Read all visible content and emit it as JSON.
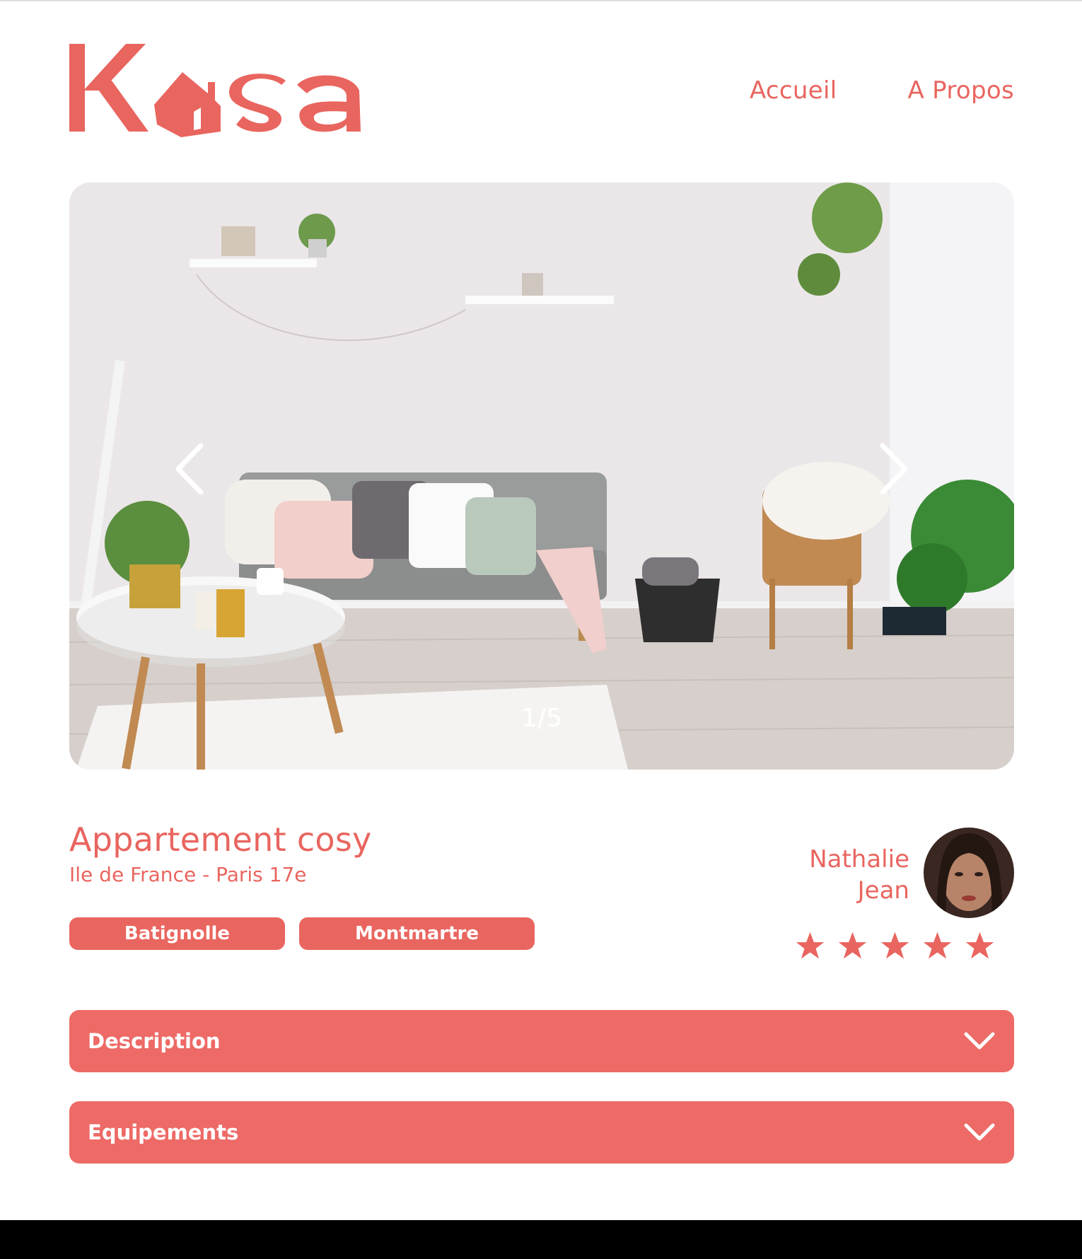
{
  "brand": {
    "name": "Kasa",
    "logo_icon": "house-icon",
    "color": "#E9655F"
  },
  "nav": {
    "home": "Accueil",
    "about": "A Propos"
  },
  "carousel": {
    "counter": "1/5",
    "prev_icon": "chevron-left-icon",
    "next_icon": "chevron-right-icon"
  },
  "listing": {
    "title": "Appartement cosy",
    "location": "Ile de France - Paris 17e",
    "tags": [
      "Batignolle",
      "Montmartre"
    ]
  },
  "host": {
    "first_name": "Nathalie",
    "last_name": "Jean",
    "rating": 5,
    "rating_max": 5
  },
  "collapses": {
    "description": {
      "label": "Description",
      "icon": "chevron-down-icon"
    },
    "equipments": {
      "label": "Equipements",
      "icon": "chevron-down-icon"
    }
  }
}
